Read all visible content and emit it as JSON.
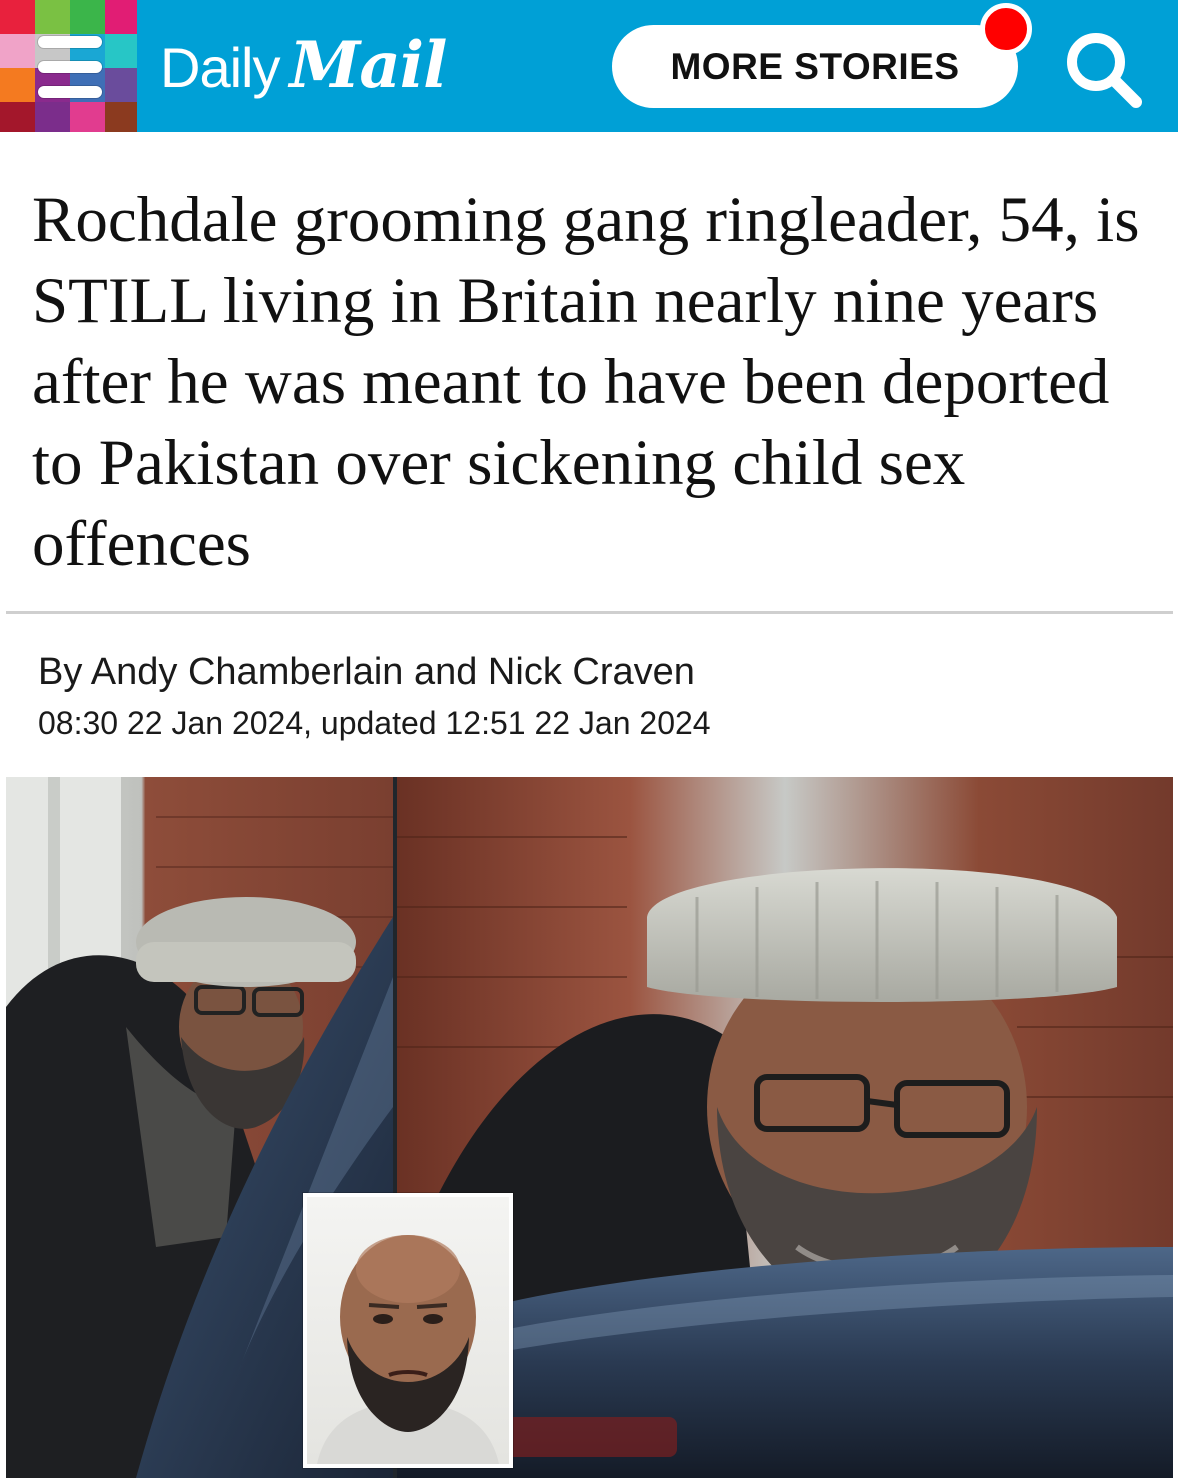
{
  "header": {
    "logo_daily": "Daily",
    "logo_mail": "Mail",
    "more_stories_label": "MORE STORIES",
    "brand_color": "#00a0d6",
    "notification_color": "#ff0000",
    "menu_icon": "hamburger-menu-icon",
    "search_icon": "search-icon"
  },
  "article": {
    "headline": "Rochdale grooming gang ringleader, 54, is STILL living in Britain nearly nine years after he was meant to have been deported to Pakistan over sickening child sex offences",
    "byline": "By Andy Chamberlain and Nick Craven",
    "dateline": "08:30 22 Jan 2024, updated 12:51 22 Jan 2024"
  }
}
